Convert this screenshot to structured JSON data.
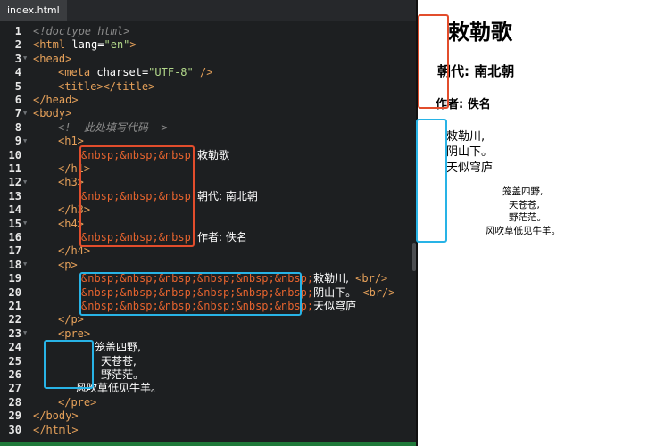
{
  "tab": {
    "label": "index.html"
  },
  "code": {
    "lines": [
      "1",
      "2",
      "3",
      "4",
      "5",
      "6",
      "7",
      "8",
      "9",
      "10",
      "11",
      "12",
      "13",
      "14",
      "15",
      "16",
      "17",
      "18",
      "19",
      "20",
      "21",
      "22",
      "23",
      "24",
      "25",
      "26",
      "27",
      "28",
      "29",
      "30"
    ],
    "l1": "<!doctype html>",
    "l2_a": "<html ",
    "l2_attr": "lang",
    "l2_eq": "=",
    "l2_val": "\"en\"",
    "l2_c": ">",
    "l3": "<head>",
    "l4_a": "<meta ",
    "l4_attr": "charset",
    "l4_eq": "=",
    "l4_val": "\"UTF-8\"",
    "l4_c": " />",
    "l5": "<title></title>",
    "l6": "</head>",
    "l7": "<body>",
    "l8": "<!--此处填写代码-->",
    "l9": "<h1>",
    "l10_e": "&nbsp;&nbsp;&nbsp;",
    "l10_t": "敕勒歌",
    "l11": "</h1>",
    "l12": "<h3>",
    "l13_e": "&nbsp;&nbsp;&nbsp;",
    "l13_t": "朝代: 南北朝",
    "l14": "</h3>",
    "l15": "<h4>",
    "l16_e": "&nbsp;&nbsp;&nbsp;",
    "l16_t": "作者: 佚名",
    "l17": "</h4>",
    "l18": "<p>",
    "l19_e": "&nbsp;&nbsp;&nbsp;&nbsp;&nbsp;&nbsp;",
    "l19_t": "敕勒川,",
    "l19_br": "<br/>",
    "l20_e": "&nbsp;&nbsp;&nbsp;&nbsp;&nbsp;&nbsp;",
    "l20_t": "阴山下。",
    "l20_br": "<br/>",
    "l21_e": "&nbsp;&nbsp;&nbsp;&nbsp;&nbsp;&nbsp;",
    "l21_t": "天似穹庐",
    "l22": "</p>",
    "l23": "<pre>",
    "l24": "笼盖四野,",
    "l25": "天苍苍,",
    "l26": "野茫茫。",
    "l27": "风吹草低见牛羊。",
    "l28": "</pre>",
    "l29": "</body>",
    "l30": "</html>"
  },
  "preview": {
    "h1": "敕勒歌",
    "h3": "朝代: 南北朝",
    "h4": "作者: 佚名",
    "p1": "敕勒川,",
    "p2": "阴山下。",
    "p3": "天似穹庐",
    "pre1": "笼盖四野,",
    "pre2": "天苍苍,",
    "pre3": "野茫茫。",
    "pre4": "风吹草低见牛羊。"
  },
  "colors": {
    "editor_bg": "#1d1f21",
    "tag": "#e6a15a",
    "entity": "#e4632e",
    "highlight_red": "#e24d2c",
    "highlight_blue": "#28b3e6"
  }
}
